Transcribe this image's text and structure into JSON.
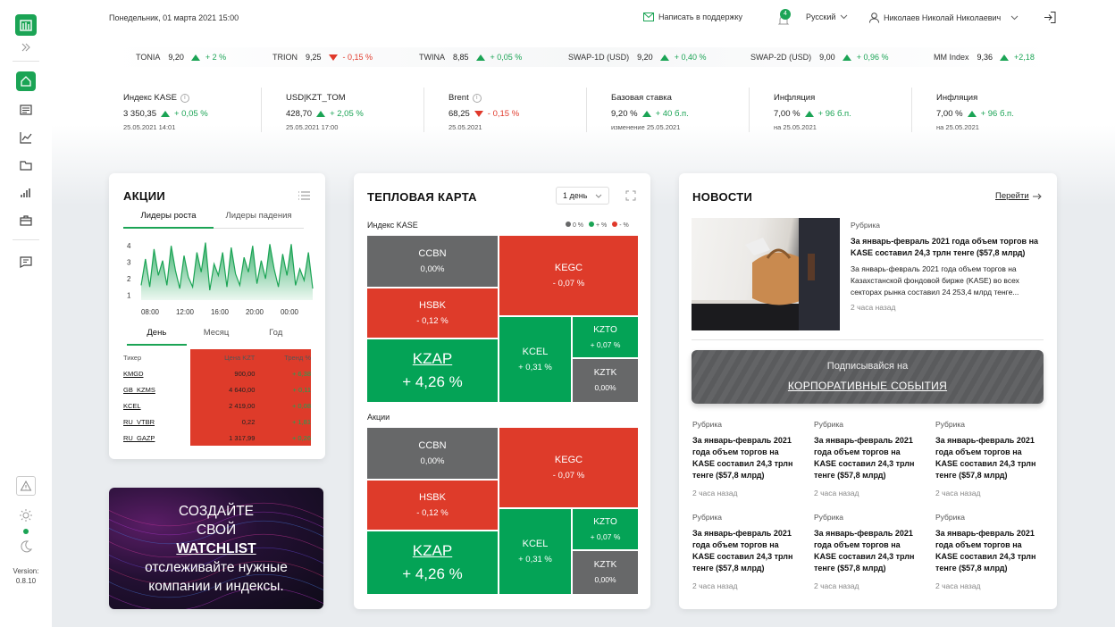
{
  "header": {
    "datetime": "Понедельник, 01 марта 2021 15:00",
    "support_label": "Написать в поддержку",
    "notifications_count": "4",
    "language": "Русский",
    "user_name": "Николаев Николай Николаевич"
  },
  "tickers": [
    {
      "name": "TONIA",
      "value": "9,20",
      "change": "+ 2 %",
      "dir": "up"
    },
    {
      "name": "TRION",
      "value": "9,25",
      "change": "- 0,15 %",
      "dir": "down"
    },
    {
      "name": "TWINA",
      "value": "8,85",
      "change": "+ 0,05 %",
      "dir": "up"
    },
    {
      "name": "SWAP-1D (USD)",
      "value": "9,20",
      "change": "+ 0,40 %",
      "dir": "up"
    },
    {
      "name": "SWAP-2D (USD)",
      "value": "9,00",
      "change": "+ 0,96 %",
      "dir": "up"
    },
    {
      "name": "MM Index",
      "value": "9,36",
      "change": "+2,18",
      "dir": "up"
    }
  ],
  "indicators": [
    {
      "title": "Индекс KASE",
      "value": "3 350,35",
      "change": "+ 0,05 %",
      "dir": "up",
      "sub": "25.05.2021 14:01"
    },
    {
      "title": "USD|KZT_TOM",
      "value": "428,70",
      "change": "+ 2,05 %",
      "dir": "up",
      "sub": "25.05.2021 17:00"
    },
    {
      "title": "Brent",
      "value": "68,25",
      "change": "- 0,15 %",
      "dir": "down",
      "sub": "25.05.2021"
    },
    {
      "title": "Базовая ставка",
      "value": "9,20 %",
      "change": "+ 40 б.п.",
      "dir": "up",
      "sub": "изменение 25.05.2021"
    },
    {
      "title": "Инфляция",
      "value": "7,00 %",
      "change": "+ 96 б.п.",
      "dir": "up",
      "sub": "на 25.05.2021"
    },
    {
      "title": "Инфляция",
      "value": "7,00 %",
      "change": "+ 96 б.п.",
      "dir": "up",
      "sub": "на 25.05.2021"
    }
  ],
  "stocks": {
    "title": "АКЦИИ",
    "tab_growth": "Лидеры роста",
    "tab_fall": "Лидеры падения",
    "period_day": "День",
    "period_month": "Месяц",
    "period_year": "Год",
    "col_ticker": "Тикер",
    "col_price": "Цена KZT",
    "col_trend": "Тренд %",
    "rows": [
      {
        "ticker": "KMGD",
        "price": "900,00",
        "trend": "+ 6,38"
      },
      {
        "ticker": "GB_KZMS",
        "price": "4 640,00",
        "trend": "+ 0,11"
      },
      {
        "ticker": "KCEL",
        "price": "2 419,00",
        "trend": "+ 0,08"
      },
      {
        "ticker": "RU_VTBR",
        "price": "0,22",
        "trend": "+ 1,81"
      },
      {
        "ticker": "RU_GAZP",
        "price": "1 317,99",
        "trend": "+ 0,26"
      }
    ]
  },
  "chart_data": {
    "type": "area",
    "title": "",
    "xlabel": "",
    "ylabel": "",
    "x_ticks": [
      "08:00",
      "12:00",
      "16:00",
      "20:00",
      "00:00"
    ],
    "y_ticks": [
      "1",
      "2",
      "3",
      "4"
    ],
    "ylim": [
      1,
      4.5
    ],
    "grid": false,
    "color": "#1ba455",
    "values": [
      1.6,
      3.2,
      1.5,
      3.8,
      2.2,
      3.1,
      1.6,
      4.0,
      2.5,
      1.4,
      3.4,
      2.1,
      1.5,
      3.6,
      2.4,
      4.2,
      1.3,
      2.9,
      2.2,
      3.6,
      1.5,
      3.9,
      2.3,
      1.6,
      3.3,
      2.4,
      4.0,
      1.7,
      3.1,
      2.0,
      4.1,
      2.6,
      1.5,
      3.5,
      2.2,
      4.1,
      1.6,
      2.6,
      1.9,
      3.6,
      1.4
    ]
  },
  "watchlist": {
    "line1": "СОЗДАЙТЕ",
    "line2": "СВОЙ",
    "line3": "WATCHLIST",
    "line4": "отслеживайте нужные",
    "line5": "компании и индексы."
  },
  "heatmap": {
    "title": "ТЕПЛОВАЯ КАРТА",
    "period": "1 день",
    "section1": "Индекс KASE",
    "section2": "Акции",
    "legend": [
      "0 %",
      "+ %",
      "- %"
    ],
    "cells": [
      {
        "name": "CCBN",
        "pct": "0,00%"
      },
      {
        "name": "HSBK",
        "pct": "- 0,12 %"
      },
      {
        "name": "KZAP",
        "pct": "+ 4,26 %"
      },
      {
        "name": "KEGC",
        "pct": "- 0,07 %"
      },
      {
        "name": "KCEL",
        "pct": "+ 0,31 %"
      },
      {
        "name": "KZTO",
        "pct": "+ 0,07 %"
      },
      {
        "name": "KZTK",
        "pct": "0,00%"
      }
    ]
  },
  "news": {
    "title": "НОВОСТИ",
    "goto": "Перейти",
    "main": {
      "rubric": "Рубрика",
      "headline": "За январь-февраль 2021 года объем торгов на KASE составил 24,3 трлн тенге ($57,8 млрд)",
      "body": "За январь-февраль 2021 года объем торгов на Казахстанской фондовой бирже (KASE) во всех секторах рынка составил 24 253,4 млрд тенге...",
      "time": "2 часа назад"
    },
    "subscribe_line1": "Подписывайся на",
    "subscribe_line2": "КОРПОРАТИВНЫЕ СОБЫТИЯ",
    "items": [
      {
        "rubric": "Рубрика",
        "headline": "За январь-февраль 2021 года объем торгов на KASE составил 24,3 трлн тенге ($57,8 млрд)",
        "time": "2 часа назад"
      },
      {
        "rubric": "Рубрика",
        "headline": "За январь-февраль 2021 года объем торгов на KASE составил 24,3 трлн тенге ($57,8 млрд)",
        "time": "2 часа назад"
      },
      {
        "rubric": "Рубрика",
        "headline": "За январь-февраль 2021 года объем торгов на KASE составил 24,3 трлн тенге ($57,8 млрд)",
        "time": "2 часа назад"
      },
      {
        "rubric": "Рубрика",
        "headline": "За январь-февраль 2021 года объем торгов на KASE составил 24,3 трлн тенге ($57,8 млрд)",
        "time": "2 часа назад"
      },
      {
        "rubric": "Рубрика",
        "headline": "За январь-февраль 2021 года объем торгов на KASE составил 24,3 трлн тенге ($57,8 млрд)",
        "time": "2 часа назад"
      },
      {
        "rubric": "Рубрика",
        "headline": "За январь-февраль 2021 года объем торгов на KASE составил 24,3 трлн тенге ($57,8 млрд)",
        "time": "2 часа назад"
      }
    ]
  },
  "sidebar": {
    "version_label": "Version:",
    "version": "0.8.10"
  },
  "colors": {
    "accent": "#1ba455",
    "down": "#e0392b",
    "neutral": "#676869"
  }
}
